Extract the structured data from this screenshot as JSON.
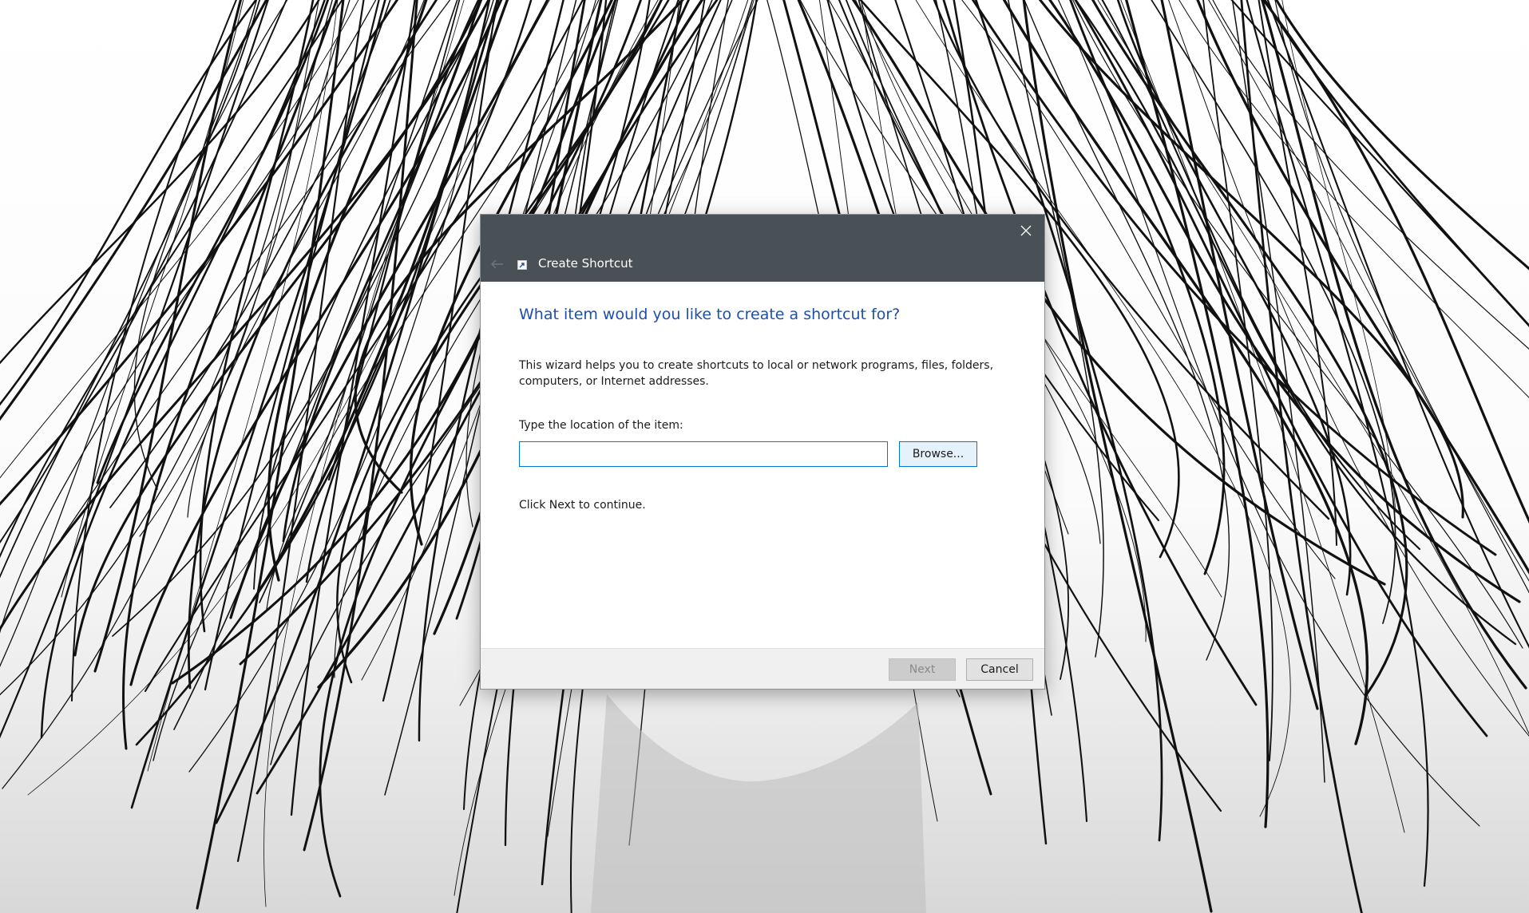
{
  "window": {
    "title": "Create Shortcut"
  },
  "wizard": {
    "heading": "What item would you like to create a shortcut for?",
    "description": "This wizard helps you to create shortcuts to local or network programs, files, folders, computers, or Internet addresses.",
    "location_label": "Type the location of the item:",
    "location_value": "",
    "browse_label": "Browse...",
    "continue_text": "Click Next to continue."
  },
  "footer": {
    "next_label": "Next",
    "cancel_label": "Cancel",
    "next_enabled": false
  },
  "icons": {
    "close": "close-icon",
    "back": "back-arrow-icon",
    "shortcut": "shortcut-icon"
  },
  "colors": {
    "titlebar": "#4a5156",
    "heading": "#1f4fa8",
    "accent": "#0078d7"
  }
}
